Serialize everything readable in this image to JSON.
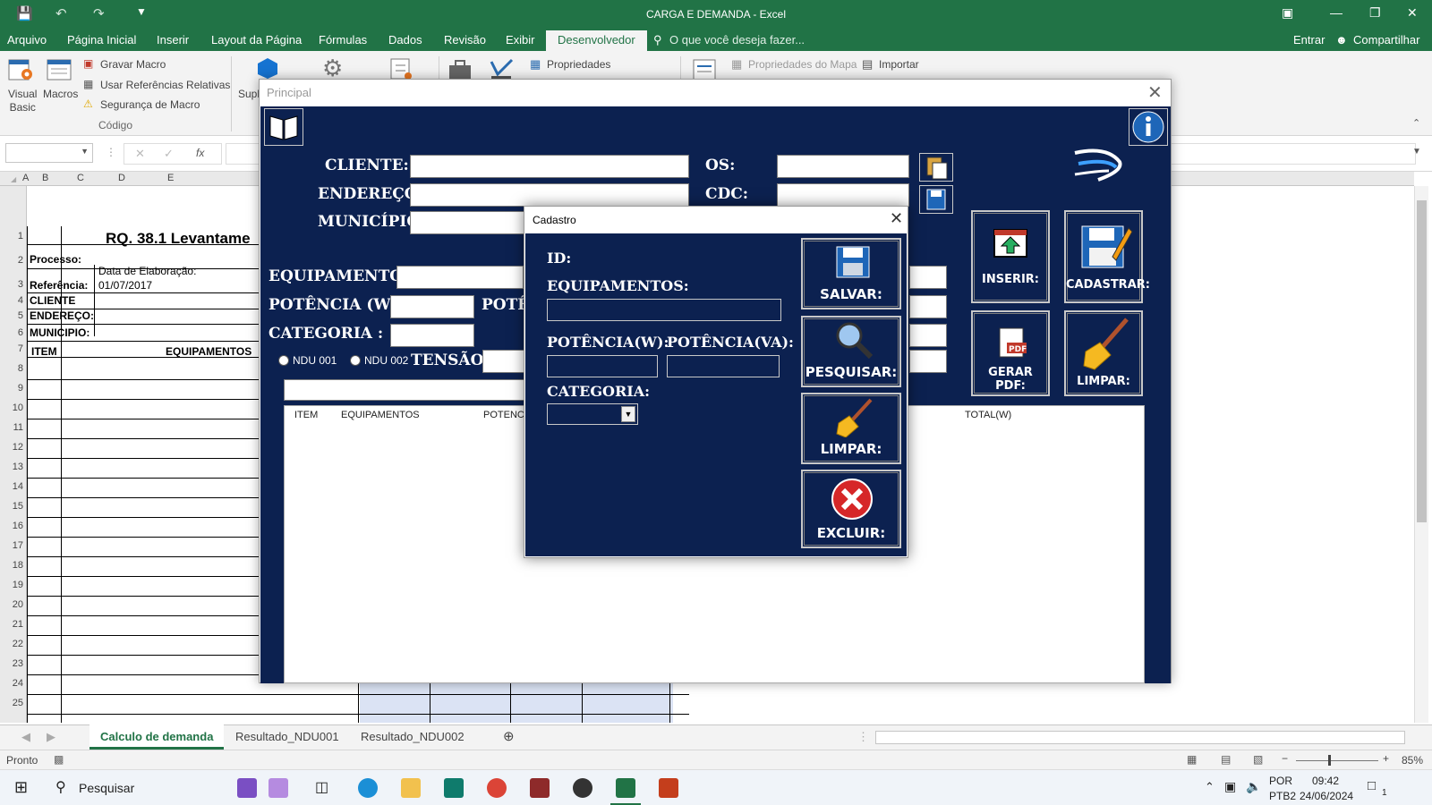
{
  "window": {
    "title": "CARGA E DEMANDA - Excel"
  },
  "menu": {
    "tabs": [
      "Arquivo",
      "Página Inicial",
      "Inserir",
      "Layout da Página",
      "Fórmulas",
      "Dados",
      "Revisão",
      "Exibir",
      "Desenvolvedor"
    ],
    "search": "O que você deseja fazer...",
    "signin": "Entrar",
    "share": "Compartilhar"
  },
  "ribbon": {
    "visual_basic": "Visual\nBasic",
    "macros": "Macros",
    "record_macro": "Gravar Macro",
    "relative_refs": "Usar Referências Relativas",
    "macro_security": "Segurança de Macro",
    "group_code": "Código",
    "addins_cut": "Supl",
    "properties": "Propriedades",
    "map_properties": "Propriedades do Mapa",
    "import": "Importar"
  },
  "formula_bar": {
    "fx": "fx"
  },
  "columns": [
    "A",
    "B",
    "C",
    "D",
    "E"
  ],
  "rows": [
    "1",
    "2",
    "3",
    "4",
    "5",
    "6",
    "7",
    "8",
    "9",
    "10",
    "11",
    "12",
    "13",
    "14",
    "15",
    "16",
    "17",
    "18",
    "19",
    "20",
    "21",
    "22",
    "23",
    "24",
    "25"
  ],
  "sheet": {
    "title_cut": "RQ. 38.1 Levantame",
    "processo": "Processo:",
    "data_elab": "Data de Elaboração:",
    "referencia": "Referência:",
    "data_val": "01/07/2017",
    "cliente": "CLIENTE",
    "endereco": "ENDEREÇO:",
    "municipio": "MUNICIPIO:",
    "item": "ITEM",
    "equipamentos": "EQUIPAMENTOS"
  },
  "sheet_tabs": [
    "Calculo de demanda",
    "Resultado_NDU001",
    "Resultado_NDU002"
  ],
  "status": {
    "ready": "Pronto",
    "zoom": "85%"
  },
  "taskbar": {
    "search": "Pesquisar",
    "lang1": "POR",
    "lang2": "PTB2",
    "time": "09:42",
    "date": "24/06/2024",
    "notif": "1"
  },
  "principal": {
    "title": "Principal",
    "cliente": "CLIENTE:",
    "endereco": "ENDEREÇO:",
    "municipio": "MUNICÍPIO:",
    "os": "OS:",
    "cdc": "CDC:",
    "equipamentos": "EQUIPAMENTOS:",
    "potencia_w": "POTÊNCIA (W) :",
    "potencia_cut": "POTÊ",
    "categoria": "CATEGORIA :",
    "ndu001": "NDU 001",
    "ndu002": "NDU 002",
    "tensao": "TENSÃO:",
    "btn_inserir": "INSERIR:",
    "btn_cadastrar": "CADASTRAR:",
    "btn_gerar_pdf": "GERAR PDF:",
    "btn_limpar": "LIMPAR:",
    "list_headers": {
      "item": "ITEM",
      "equip": "EQUIPAMENTOS",
      "pot": "POTENCI",
      "total": "TOTAL(W)"
    }
  },
  "cadastro": {
    "title": "Cadastro",
    "id": "ID:",
    "equipamentos": "EQUIPAMENTOS:",
    "potencia_w": "POTÊNCIA(W):",
    "potencia_va": "POTÊNCIA(VA):",
    "categoria": "CATEGORIA:",
    "btn_salvar": "SALVAR:",
    "btn_pesquisar": "PESQUISAR:",
    "btn_limpar": "LIMPAR:",
    "btn_excluir": "EXCLUIR:"
  },
  "colors": {
    "excel_green": "#217346",
    "form_navy": "#0c2150"
  }
}
